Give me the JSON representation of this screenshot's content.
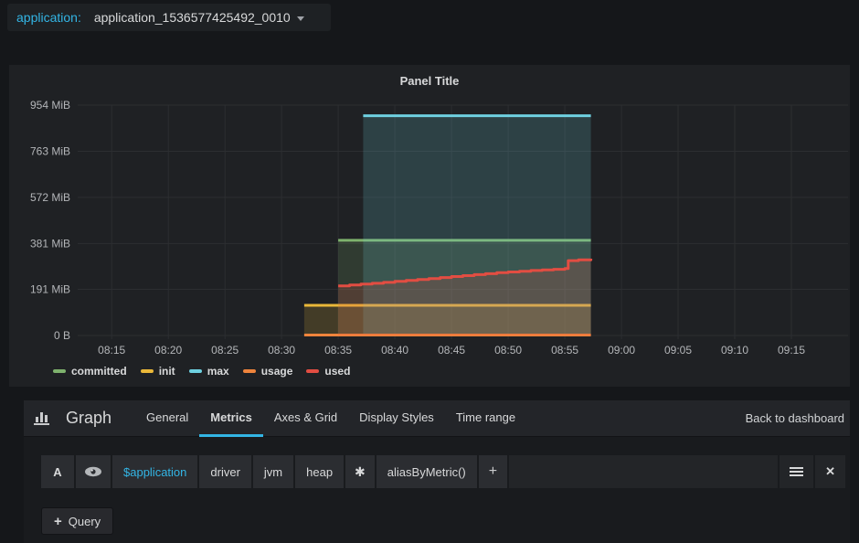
{
  "variable_bar": {
    "label": "application:",
    "value": "application_1536577425492_0010"
  },
  "panel": {
    "title": "Panel Title"
  },
  "chart_data": {
    "type": "area",
    "title": "Panel Title",
    "y_unit": "MiB",
    "x_domain_minutes": [
      492,
      560
    ],
    "y_domain": [
      0,
      954
    ],
    "grid": true,
    "legend_position": "bottom-left",
    "y_ticks": [
      {
        "v": 0,
        "label": "0 B"
      },
      {
        "v": 191,
        "label": "191 MiB"
      },
      {
        "v": 381,
        "label": "381 MiB"
      },
      {
        "v": 572,
        "label": "572 MiB"
      },
      {
        "v": 763,
        "label": "763 MiB"
      },
      {
        "v": 954,
        "label": "954 MiB"
      }
    ],
    "x_ticks": [
      {
        "t": 495,
        "label": "08:15"
      },
      {
        "t": 500,
        "label": "08:20"
      },
      {
        "t": 505,
        "label": "08:25"
      },
      {
        "t": 510,
        "label": "08:30"
      },
      {
        "t": 515,
        "label": "08:35"
      },
      {
        "t": 520,
        "label": "08:40"
      },
      {
        "t": 525,
        "label": "08:45"
      },
      {
        "t": 530,
        "label": "08:50"
      },
      {
        "t": 535,
        "label": "08:55"
      },
      {
        "t": 540,
        "label": "09:00"
      },
      {
        "t": 545,
        "label": "09:05"
      },
      {
        "t": 550,
        "label": "09:10"
      },
      {
        "t": 555,
        "label": "09:15"
      }
    ],
    "series": [
      {
        "name": "committed",
        "color": "#7EB26D",
        "fill_opacity": 0.18,
        "line_width": 3,
        "step": false,
        "points": [
          [
            515,
            394
          ],
          [
            537.3,
            394
          ]
        ]
      },
      {
        "name": "init",
        "color": "#EAB839",
        "fill_opacity": 0.18,
        "line_width": 3,
        "step": false,
        "points": [
          [
            512,
            125
          ],
          [
            537.3,
            125
          ]
        ]
      },
      {
        "name": "max",
        "color": "#6ED0E0",
        "fill_opacity": 0.18,
        "line_width": 3,
        "step": false,
        "points": [
          [
            517.2,
            910
          ],
          [
            537.3,
            910
          ]
        ]
      },
      {
        "name": "usage",
        "color": "#EF843C",
        "fill_opacity": 0.18,
        "line_width": 3,
        "step": false,
        "points": [
          [
            512,
            2
          ],
          [
            537.3,
            2
          ]
        ]
      },
      {
        "name": "used",
        "color": "#E24D42",
        "fill_opacity": 0.18,
        "line_width": 3,
        "step": true,
        "points": [
          [
            515,
            205
          ],
          [
            516,
            209
          ],
          [
            517,
            213
          ],
          [
            518,
            216
          ],
          [
            519,
            220
          ],
          [
            520,
            224
          ],
          [
            521,
            228
          ],
          [
            522,
            232
          ],
          [
            523,
            236
          ],
          [
            524,
            240
          ],
          [
            525,
            244
          ],
          [
            526,
            248
          ],
          [
            527,
            252
          ],
          [
            528,
            256
          ],
          [
            529,
            260
          ],
          [
            530,
            263
          ],
          [
            531,
            266
          ],
          [
            532,
            269
          ],
          [
            533,
            272
          ],
          [
            534,
            274
          ],
          [
            535,
            277
          ],
          [
            535.3,
            310
          ],
          [
            536.2,
            313
          ],
          [
            537.3,
            318
          ]
        ]
      }
    ]
  },
  "editor": {
    "panel_type_label": "Graph",
    "tabs": [
      "General",
      "Metrics",
      "Axes & Grid",
      "Display Styles",
      "Time range"
    ],
    "active_tab": "Metrics",
    "back_link": "Back to dashboard",
    "query": {
      "ref": "A",
      "segments": [
        "$application",
        "driver",
        "jvm",
        "heap",
        "✱",
        "aliasByMetric()"
      ],
      "add_segment_label": "+",
      "add_query_label": "Query"
    }
  },
  "icons": {
    "close": "✕",
    "plus": "+"
  },
  "colors": {
    "accent_cyan": "#33B5E5",
    "tab_underline": "#33B5E5",
    "grid_line": "#2c2e31",
    "committed": "#7EB26D",
    "init": "#EAB839",
    "max": "#6ED0E0",
    "usage": "#EF843C",
    "used": "#E24D42"
  }
}
